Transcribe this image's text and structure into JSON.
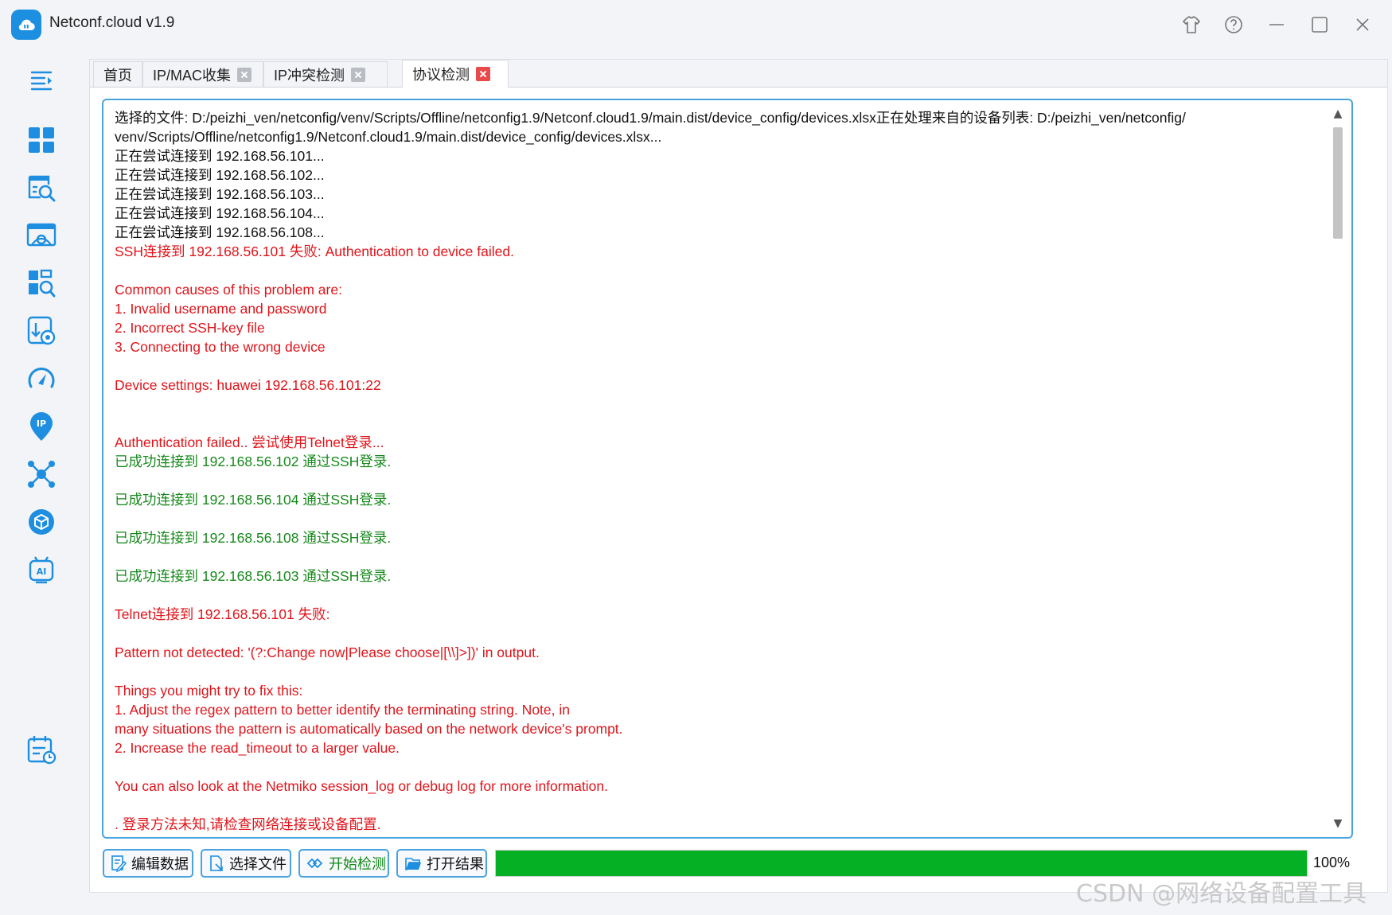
{
  "app": {
    "title": "Netconf.cloud v1.9"
  },
  "colors": {
    "accent": "#4aa3df",
    "error_text": "#e0141a",
    "success_text": "#16891b",
    "progress": "#06b025"
  },
  "window_controls": [
    {
      "name": "skin-icon"
    },
    {
      "name": "help-icon"
    },
    {
      "name": "minimize-icon"
    },
    {
      "name": "maximize-icon"
    },
    {
      "name": "close-icon"
    }
  ],
  "sidebar": {
    "items": [
      {
        "name": "menu-toggle-icon"
      },
      {
        "name": "dashboard-icon"
      },
      {
        "name": "ip-search-icon"
      },
      {
        "name": "config-icon"
      },
      {
        "name": "inspect-icon"
      },
      {
        "name": "download-settings-icon"
      },
      {
        "name": "speed-gauge-icon"
      },
      {
        "name": "ip-location-icon"
      },
      {
        "name": "topology-icon"
      },
      {
        "name": "package-icon"
      },
      {
        "name": "ai-robot-icon"
      },
      {
        "name": "schedule-icon"
      }
    ]
  },
  "tabs": [
    {
      "label": "首页",
      "closable": false,
      "active": false
    },
    {
      "label": "IP/MAC收集",
      "closable": true,
      "active": false
    },
    {
      "label": "IP冲突检测",
      "closable": true,
      "active": false
    },
    {
      "label": "协议检测",
      "closable": true,
      "active": true
    }
  ],
  "log": {
    "lines": [
      {
        "text": "选择的文件: D:/peizhi_ven/netconfig/venv/Scripts/Offline/netconfig1.9/Netconf.cloud1.9/main.dist/device_config/devices.xlsx正在处理来自的设备列表: D:/peizhi_ven/netconfig/",
        "color": "black"
      },
      {
        "text": "venv/Scripts/Offline/netconfig1.9/Netconf.cloud1.9/main.dist/device_config/devices.xlsx...",
        "color": "black"
      },
      {
        "text": "正在尝试连接到 192.168.56.101...",
        "color": "black"
      },
      {
        "text": "正在尝试连接到 192.168.56.102...",
        "color": "black"
      },
      {
        "text": "正在尝试连接到 192.168.56.103...",
        "color": "black"
      },
      {
        "text": "正在尝试连接到 192.168.56.104...",
        "color": "black"
      },
      {
        "text": "正在尝试连接到 192.168.56.108...",
        "color": "black"
      },
      {
        "text": "SSH连接到 192.168.56.101 失败: Authentication to device failed.",
        "color": "red"
      },
      {
        "text": "",
        "color": "red"
      },
      {
        "text": "Common causes of this problem are:",
        "color": "red"
      },
      {
        "text": "1. Invalid username and password",
        "color": "red"
      },
      {
        "text": "2. Incorrect SSH-key file",
        "color": "red"
      },
      {
        "text": "3. Connecting to the wrong device",
        "color": "red"
      },
      {
        "text": "",
        "color": "red"
      },
      {
        "text": "Device settings: huawei 192.168.56.101:22",
        "color": "red"
      },
      {
        "text": "",
        "color": "red"
      },
      {
        "text": "",
        "color": "red"
      },
      {
        "text": "Authentication failed.. 尝试使用Telnet登录...",
        "color": "red"
      },
      {
        "text": "已成功连接到 192.168.56.102 通过SSH登录.",
        "color": "green"
      },
      {
        "text": "",
        "color": "green"
      },
      {
        "text": "已成功连接到 192.168.56.104 通过SSH登录.",
        "color": "green"
      },
      {
        "text": "",
        "color": "green"
      },
      {
        "text": "已成功连接到 192.168.56.108 通过SSH登录.",
        "color": "green"
      },
      {
        "text": "",
        "color": "green"
      },
      {
        "text": "已成功连接到 192.168.56.103 通过SSH登录.",
        "color": "green"
      },
      {
        "text": "",
        "color": "green"
      },
      {
        "text": "Telnet连接到 192.168.56.101 失败:",
        "color": "red"
      },
      {
        "text": "",
        "color": "red"
      },
      {
        "text": "Pattern not detected: '(?:Change now|Please choose|[\\\\]>])' in output.",
        "color": "red"
      },
      {
        "text": "",
        "color": "red"
      },
      {
        "text": "Things you might try to fix this:",
        "color": "red"
      },
      {
        "text": "1. Adjust the regex pattern to better identify the terminating string. Note, in",
        "color": "red"
      },
      {
        "text": "many situations the pattern is automatically based on the network device's prompt.",
        "color": "red"
      },
      {
        "text": "2. Increase the read_timeout to a larger value.",
        "color": "red"
      },
      {
        "text": "",
        "color": "red"
      },
      {
        "text": "You can also look at the Netmiko session_log or debug log for more information.",
        "color": "red"
      },
      {
        "text": "",
        "color": "red"
      },
      {
        "text": ". 登录方法未知,请检查网络连接或设备配置.",
        "color": "red"
      }
    ]
  },
  "toolbar": {
    "edit_label": "编辑数据",
    "select_label": "选择文件",
    "start_label": "开始检测",
    "open_label": "打开结果"
  },
  "progress": {
    "value": 1.0,
    "label": "100%"
  },
  "watermark": "CSDN @网络设备配置工具"
}
